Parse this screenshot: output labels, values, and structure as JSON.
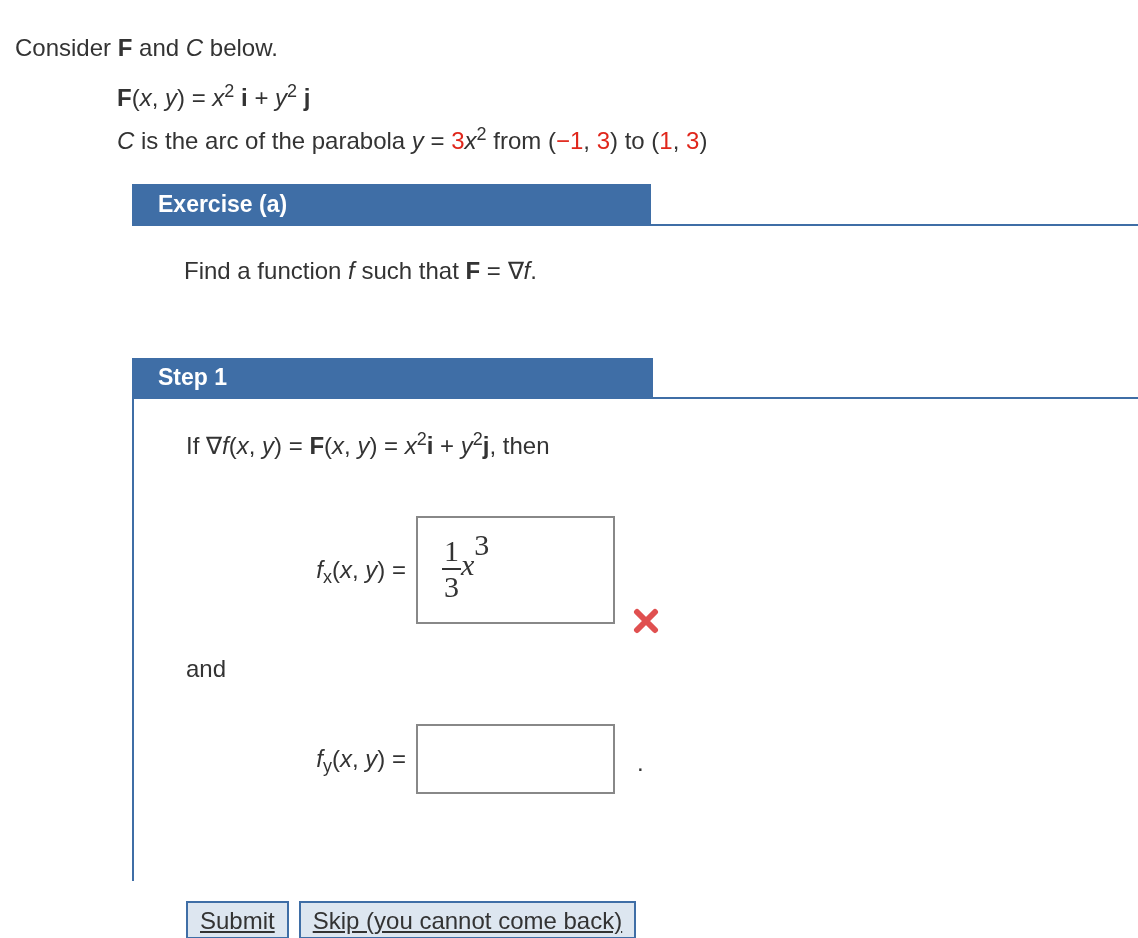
{
  "intro": "Consider **F** and *C* below.",
  "field_formula": "**F**(*x*, *y*) = *x*$^{2}$ **i** + *y*$^{2}$ **j**",
  "curve_segments": [
    {
      "text": "*C* is the arc of the parabola *y* = ",
      "highlight": false
    },
    {
      "text": "3",
      "highlight": true
    },
    {
      "text": "*x*$^{2}$ from (",
      "highlight": false
    },
    {
      "text": "−1",
      "highlight": true
    },
    {
      "text": ", ",
      "highlight": false
    },
    {
      "text": "3",
      "highlight": true
    },
    {
      "text": ") to (",
      "highlight": false
    },
    {
      "text": "1",
      "highlight": true
    },
    {
      "text": ", ",
      "highlight": false
    },
    {
      "text": "3",
      "highlight": true
    },
    {
      "text": ")",
      "highlight": false
    }
  ],
  "exercise": {
    "title": "Exercise (a)",
    "prompt": "Find a function *f* such that **F** = ∇*f*."
  },
  "step": {
    "title": "Step 1",
    "lead": "If ∇*f*(*x*, *y*) = **F**(*x*, *y*) = *x*$^{2}$**i** + *y*$^{2}$**j**, then",
    "answers": [
      {
        "label": "*f*$_{x}$(*x*, *y*) =",
        "value": {
          "numerator": "1",
          "denominator": "3",
          "base": "x",
          "exponent": "3"
        },
        "correct": false
      },
      {
        "label": "*f*$_{y}$(*x*, *y*) =",
        "after": "."
      }
    ],
    "connector": "and",
    "buttons": [
      "Submit",
      "Skip (you cannot come back)"
    ]
  }
}
